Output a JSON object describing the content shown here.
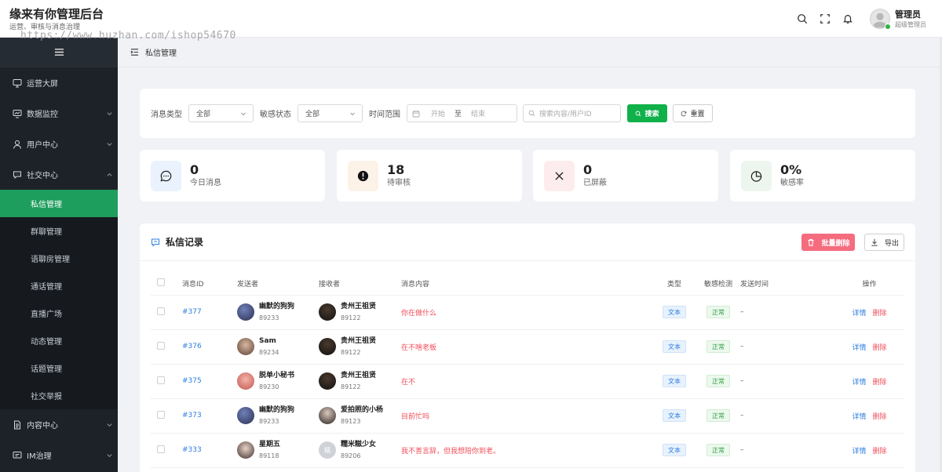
{
  "header": {
    "title": "缘来有你管理后台",
    "subtitle": "运营、审核与消息治理",
    "watermark": "https://www.huzhan.com/ishop54670",
    "user": {
      "name": "管理员",
      "role": "超级管理员"
    }
  },
  "sidebar": {
    "items": [
      {
        "label": "运营大屏",
        "icon": "monitor-icon"
      },
      {
        "label": "数据监控",
        "icon": "chart-icon"
      },
      {
        "label": "用户中心",
        "icon": "user-icon"
      },
      {
        "label": "社交中心",
        "icon": "chat-icon"
      }
    ],
    "social_sub": [
      "私信管理",
      "群聊管理",
      "语聊房管理",
      "通话管理",
      "直播广场",
      "动态管理",
      "话题管理",
      "社交举报"
    ],
    "more_items": [
      {
        "label": "内容中心",
        "icon": "document-icon"
      },
      {
        "label": "IM治理",
        "icon": "message-icon"
      }
    ]
  },
  "breadcrumb": {
    "current": "私信管理"
  },
  "filter": {
    "msg_type_label": "消息类型",
    "msg_type_value": "全部",
    "sensitive_label": "敏感状态",
    "sensitive_value": "全部",
    "time_label": "时间范围",
    "start_placeholder": "开始",
    "range_sep": "至",
    "end_placeholder": "结束",
    "search_placeholder": "搜索内容/用户ID",
    "search_btn": "搜索",
    "reset_btn": "重置"
  },
  "stats": [
    {
      "value": "0",
      "label": "今日消息",
      "icon": "message-icon",
      "bg": "#eaf2fd"
    },
    {
      "value": "18",
      "label": "待审核",
      "icon": "alert-icon",
      "bg": "#fdf2e7"
    },
    {
      "value": "0",
      "label": "已屏蔽",
      "icon": "close-icon",
      "bg": "#fdecee"
    },
    {
      "value": "0%",
      "label": "敏感率",
      "icon": "pie-icon",
      "bg": "#edf6ee"
    }
  ],
  "table": {
    "title": "私信记录",
    "batch_delete": "批量删除",
    "export": "导出",
    "columns": [
      "消息ID",
      "发送者",
      "接收者",
      "消息内容",
      "类型",
      "敏感检测",
      "发送时间",
      "操作"
    ],
    "rows": [
      {
        "id": "#377",
        "sender": {
          "name": "幽默的狗狗",
          "uid": "89233"
        },
        "receiver": {
          "name": "贵州王祖贤",
          "uid": "89122"
        },
        "content": "你在做什么",
        "type": "文本",
        "sensitive": "正常",
        "time": "–"
      },
      {
        "id": "#376",
        "sender": {
          "name": "Sam",
          "uid": "89234"
        },
        "receiver": {
          "name": "贵州王祖贤",
          "uid": "89122"
        },
        "content": "在不啥老板",
        "type": "文本",
        "sensitive": "正常",
        "time": "–"
      },
      {
        "id": "#375",
        "sender": {
          "name": "脱单小秘书",
          "uid": "89230"
        },
        "receiver": {
          "name": "贵州王祖贤",
          "uid": "89122"
        },
        "content": "在不",
        "type": "文本",
        "sensitive": "正常",
        "time": "–"
      },
      {
        "id": "#373",
        "sender": {
          "name": "幽默的狗狗",
          "uid": "89233"
        },
        "receiver": {
          "name": "爱拍照的小杨",
          "uid": "89123"
        },
        "content": "目前忙吗",
        "type": "文本",
        "sensitive": "正常",
        "time": "–"
      },
      {
        "id": "#333",
        "sender": {
          "name": "星期五",
          "uid": "89118"
        },
        "receiver": {
          "name": "糯米糍少女",
          "uid": "89206"
        },
        "content": "我不善言辞，但我想陪你到老。",
        "type": "文本",
        "sensitive": "正常",
        "time": "–"
      }
    ],
    "detail_label": "详情",
    "delete_label": "删除",
    "placeholder_avatar_text": "糯"
  }
}
